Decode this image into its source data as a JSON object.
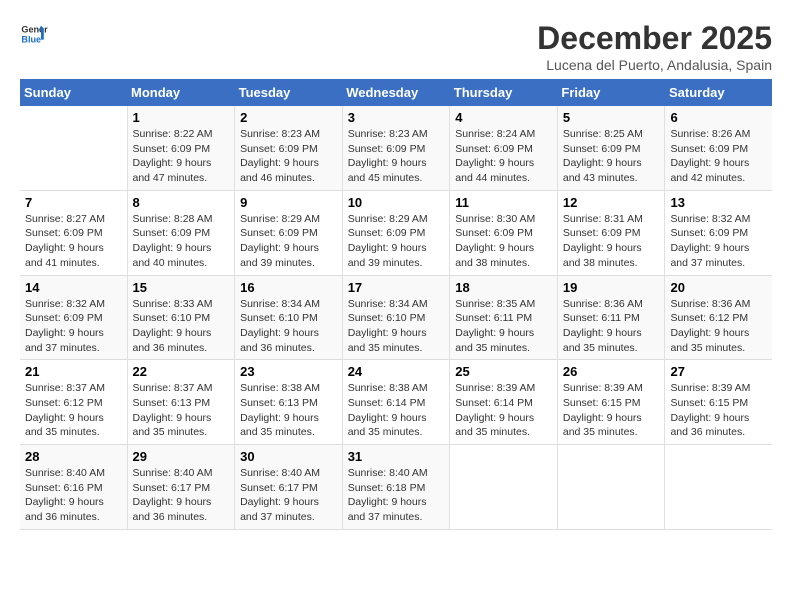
{
  "logo": {
    "line1": "General",
    "line2": "Blue"
  },
  "title": "December 2025",
  "subtitle": "Lucena del Puerto, Andalusia, Spain",
  "days_header": [
    "Sunday",
    "Monday",
    "Tuesday",
    "Wednesday",
    "Thursday",
    "Friday",
    "Saturday"
  ],
  "weeks": [
    [
      {
        "day": "",
        "info": ""
      },
      {
        "day": "1",
        "info": "Sunrise: 8:22 AM\nSunset: 6:09 PM\nDaylight: 9 hours\nand 47 minutes."
      },
      {
        "day": "2",
        "info": "Sunrise: 8:23 AM\nSunset: 6:09 PM\nDaylight: 9 hours\nand 46 minutes."
      },
      {
        "day": "3",
        "info": "Sunrise: 8:23 AM\nSunset: 6:09 PM\nDaylight: 9 hours\nand 45 minutes."
      },
      {
        "day": "4",
        "info": "Sunrise: 8:24 AM\nSunset: 6:09 PM\nDaylight: 9 hours\nand 44 minutes."
      },
      {
        "day": "5",
        "info": "Sunrise: 8:25 AM\nSunset: 6:09 PM\nDaylight: 9 hours\nand 43 minutes."
      },
      {
        "day": "6",
        "info": "Sunrise: 8:26 AM\nSunset: 6:09 PM\nDaylight: 9 hours\nand 42 minutes."
      }
    ],
    [
      {
        "day": "7",
        "info": "Sunrise: 8:27 AM\nSunset: 6:09 PM\nDaylight: 9 hours\nand 41 minutes."
      },
      {
        "day": "8",
        "info": "Sunrise: 8:28 AM\nSunset: 6:09 PM\nDaylight: 9 hours\nand 40 minutes."
      },
      {
        "day": "9",
        "info": "Sunrise: 8:29 AM\nSunset: 6:09 PM\nDaylight: 9 hours\nand 39 minutes."
      },
      {
        "day": "10",
        "info": "Sunrise: 8:29 AM\nSunset: 6:09 PM\nDaylight: 9 hours\nand 39 minutes."
      },
      {
        "day": "11",
        "info": "Sunrise: 8:30 AM\nSunset: 6:09 PM\nDaylight: 9 hours\nand 38 minutes."
      },
      {
        "day": "12",
        "info": "Sunrise: 8:31 AM\nSunset: 6:09 PM\nDaylight: 9 hours\nand 38 minutes."
      },
      {
        "day": "13",
        "info": "Sunrise: 8:32 AM\nSunset: 6:09 PM\nDaylight: 9 hours\nand 37 minutes."
      }
    ],
    [
      {
        "day": "14",
        "info": "Sunrise: 8:32 AM\nSunset: 6:09 PM\nDaylight: 9 hours\nand 37 minutes."
      },
      {
        "day": "15",
        "info": "Sunrise: 8:33 AM\nSunset: 6:10 PM\nDaylight: 9 hours\nand 36 minutes."
      },
      {
        "day": "16",
        "info": "Sunrise: 8:34 AM\nSunset: 6:10 PM\nDaylight: 9 hours\nand 36 minutes."
      },
      {
        "day": "17",
        "info": "Sunrise: 8:34 AM\nSunset: 6:10 PM\nDaylight: 9 hours\nand 35 minutes."
      },
      {
        "day": "18",
        "info": "Sunrise: 8:35 AM\nSunset: 6:11 PM\nDaylight: 9 hours\nand 35 minutes."
      },
      {
        "day": "19",
        "info": "Sunrise: 8:36 AM\nSunset: 6:11 PM\nDaylight: 9 hours\nand 35 minutes."
      },
      {
        "day": "20",
        "info": "Sunrise: 8:36 AM\nSunset: 6:12 PM\nDaylight: 9 hours\nand 35 minutes."
      }
    ],
    [
      {
        "day": "21",
        "info": "Sunrise: 8:37 AM\nSunset: 6:12 PM\nDaylight: 9 hours\nand 35 minutes."
      },
      {
        "day": "22",
        "info": "Sunrise: 8:37 AM\nSunset: 6:13 PM\nDaylight: 9 hours\nand 35 minutes."
      },
      {
        "day": "23",
        "info": "Sunrise: 8:38 AM\nSunset: 6:13 PM\nDaylight: 9 hours\nand 35 minutes."
      },
      {
        "day": "24",
        "info": "Sunrise: 8:38 AM\nSunset: 6:14 PM\nDaylight: 9 hours\nand 35 minutes."
      },
      {
        "day": "25",
        "info": "Sunrise: 8:39 AM\nSunset: 6:14 PM\nDaylight: 9 hours\nand 35 minutes."
      },
      {
        "day": "26",
        "info": "Sunrise: 8:39 AM\nSunset: 6:15 PM\nDaylight: 9 hours\nand 35 minutes."
      },
      {
        "day": "27",
        "info": "Sunrise: 8:39 AM\nSunset: 6:15 PM\nDaylight: 9 hours\nand 36 minutes."
      }
    ],
    [
      {
        "day": "28",
        "info": "Sunrise: 8:40 AM\nSunset: 6:16 PM\nDaylight: 9 hours\nand 36 minutes."
      },
      {
        "day": "29",
        "info": "Sunrise: 8:40 AM\nSunset: 6:17 PM\nDaylight: 9 hours\nand 36 minutes."
      },
      {
        "day": "30",
        "info": "Sunrise: 8:40 AM\nSunset: 6:17 PM\nDaylight: 9 hours\nand 37 minutes."
      },
      {
        "day": "31",
        "info": "Sunrise: 8:40 AM\nSunset: 6:18 PM\nDaylight: 9 hours\nand 37 minutes."
      },
      {
        "day": "",
        "info": ""
      },
      {
        "day": "",
        "info": ""
      },
      {
        "day": "",
        "info": ""
      }
    ]
  ]
}
